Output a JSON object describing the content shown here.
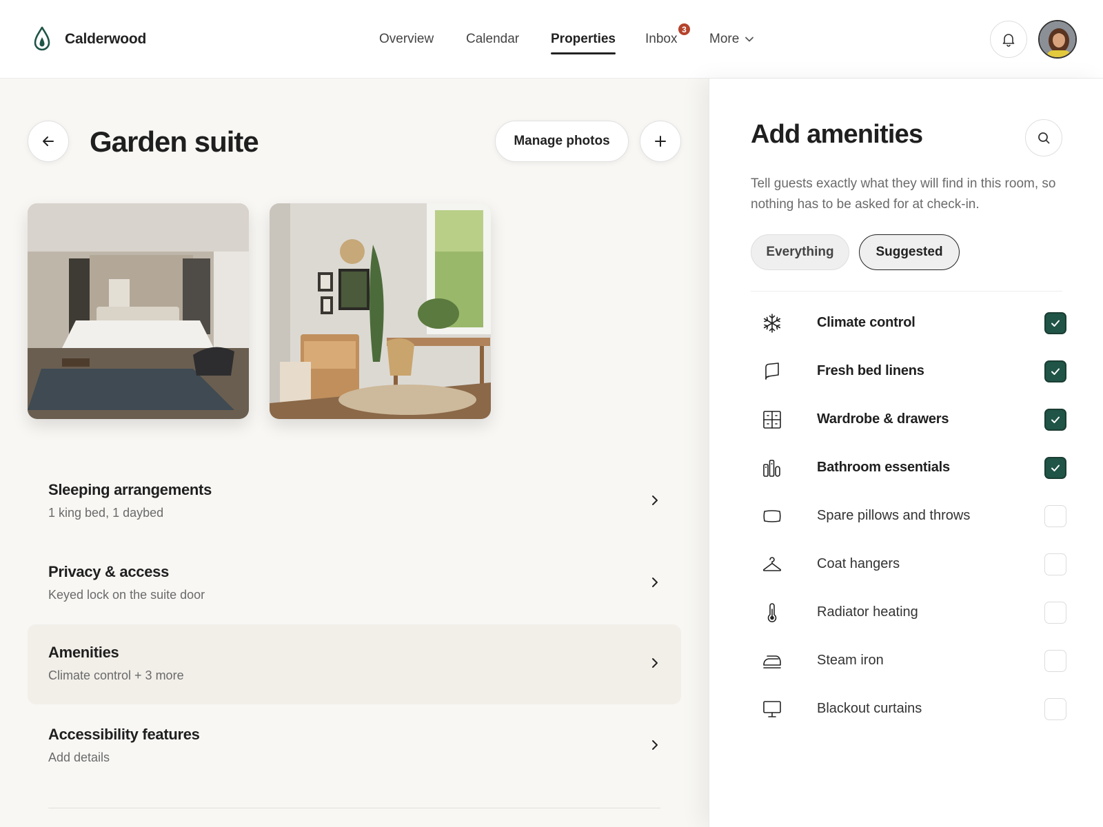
{
  "app": {
    "name": "Calderwood"
  },
  "nav": {
    "overview": "Overview",
    "calendar": "Calendar",
    "properties": "Properties",
    "inbox": "Inbox",
    "inbox_badge": "3",
    "more": "More"
  },
  "page": {
    "title": "Garden suite",
    "manage_photos": "Manage photos"
  },
  "sections": [
    {
      "title": "Sleeping arrangements",
      "subtitle": "1 king bed, 1 daybed"
    },
    {
      "title": "Privacy & access",
      "subtitle": "Keyed lock on the suite door"
    },
    {
      "title": "Amenities",
      "subtitle": "Climate control + 3 more"
    },
    {
      "title": "Accessibility features",
      "subtitle": "Add details"
    }
  ],
  "panel": {
    "title": "Add amenities",
    "description": "Tell guests exactly what they will find in this room, so nothing has to be asked for at check-in.",
    "filters": {
      "everything": "Everything",
      "suggested": "Suggested"
    },
    "amenities": [
      {
        "label": "Climate control",
        "icon": "snowflake-icon",
        "checked": true
      },
      {
        "label": "Fresh bed linens",
        "icon": "linens-icon",
        "checked": true
      },
      {
        "label": "Wardrobe & drawers",
        "icon": "wardrobe-icon",
        "checked": true
      },
      {
        "label": "Bathroom essentials",
        "icon": "toiletries-icon",
        "checked": true
      },
      {
        "label": "Spare pillows and throws",
        "icon": "pillow-icon",
        "checked": false
      },
      {
        "label": "Coat hangers",
        "icon": "hanger-icon",
        "checked": false
      },
      {
        "label": "Radiator heating",
        "icon": "thermometer-icon",
        "checked": false
      },
      {
        "label": "Steam iron",
        "icon": "iron-icon",
        "checked": false
      },
      {
        "label": "Blackout curtains",
        "icon": "monitor-icon",
        "checked": false
      }
    ]
  },
  "colors": {
    "accent": "#1f5446",
    "badge": "#b5432c",
    "background": "#f8f7f4"
  }
}
